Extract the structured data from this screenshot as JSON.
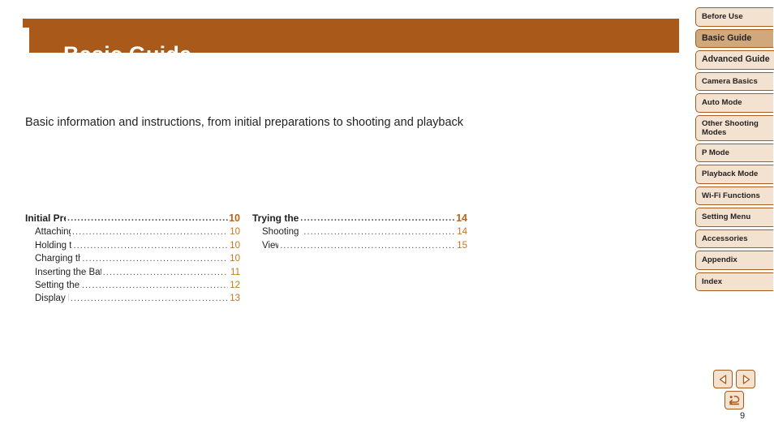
{
  "page": {
    "title": "Basic Guide",
    "intro": "Basic information and instructions, from initial preparations to shooting and playback",
    "folio": "9"
  },
  "colors": {
    "banner": "#a9591a",
    "tab_inactive": "#f4e2d0",
    "tab_active": "#d0a87b",
    "tab_border": "#a9591a",
    "page_number": "#c4761f",
    "text": "#231f20"
  },
  "toc": {
    "columns": [
      {
        "heading": {
          "label": "Initial Preparations",
          "page": "10"
        },
        "items": [
          {
            "label": "Attaching the Strap",
            "page": "10"
          },
          {
            "label": "Holding the Camera",
            "page": "10"
          },
          {
            "label": "Charging the Battery Pack",
            "page": "10"
          },
          {
            "label": "Inserting the Battery Pack and Memory Card",
            "page": "11"
          },
          {
            "label": "Setting the Date and Time",
            "page": "12"
          },
          {
            "label": "Display Language",
            "page": "13"
          }
        ]
      },
      {
        "heading": {
          "label": "Trying the Camera Out",
          "page": "14"
        },
        "items": [
          {
            "label": "Shooting (Smart Auto)",
            "page": "14"
          },
          {
            "label": "Viewing",
            "page": "15"
          }
        ]
      }
    ],
    "leader": "......................................................................................................"
  },
  "sidebar": {
    "items": [
      {
        "label": "Before Use",
        "active": false,
        "wide": false,
        "two_line": false
      },
      {
        "label": "Basic Guide",
        "active": true,
        "wide": false,
        "two_line": false
      },
      {
        "label": "Advanced Guide",
        "active": false,
        "wide": true,
        "two_line": false
      },
      {
        "label": "Camera Basics",
        "active": false,
        "wide": false,
        "two_line": false
      },
      {
        "label": "Auto Mode",
        "active": false,
        "wide": false,
        "two_line": false
      },
      {
        "label": "Other Shooting Modes",
        "active": false,
        "wide": false,
        "two_line": true
      },
      {
        "label": "P Mode",
        "active": false,
        "wide": false,
        "two_line": false
      },
      {
        "label": "Playback Mode",
        "active": false,
        "wide": false,
        "two_line": false
      },
      {
        "label": "Wi-Fi Functions",
        "active": false,
        "wide": false,
        "two_line": false
      },
      {
        "label": "Setting Menu",
        "active": false,
        "wide": false,
        "two_line": false
      },
      {
        "label": "Accessories",
        "active": false,
        "wide": false,
        "two_line": false
      },
      {
        "label": "Appendix",
        "active": false,
        "wide": false,
        "two_line": false
      },
      {
        "label": "Index",
        "active": false,
        "wide": false,
        "two_line": false
      }
    ]
  },
  "nav": {
    "previous_icon": "triangle-left-icon",
    "next_icon": "triangle-right-icon",
    "return_icon": "return-arrow-icon"
  }
}
